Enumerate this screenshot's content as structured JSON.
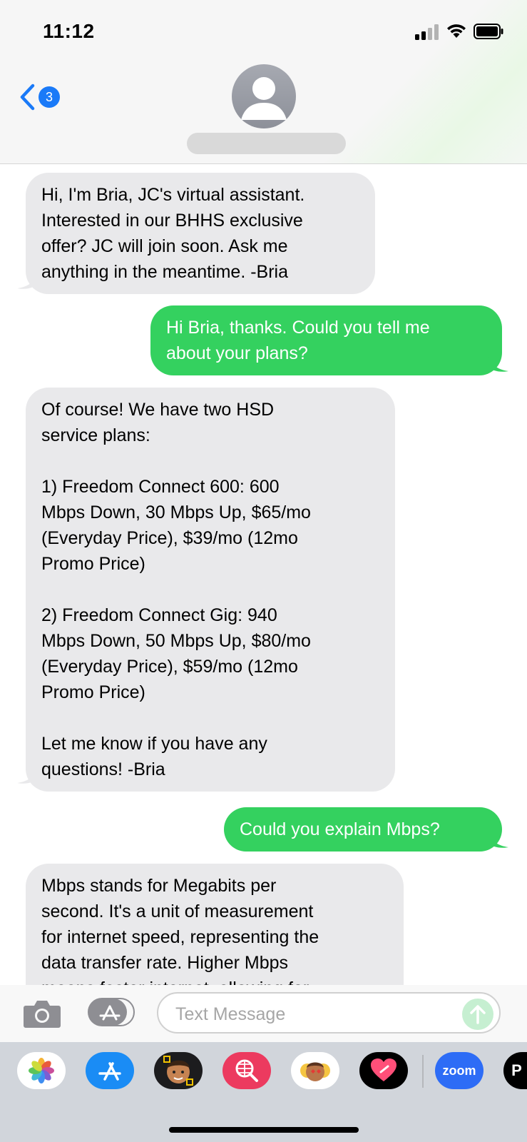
{
  "status_bar": {
    "time": "11:12"
  },
  "nav": {
    "back_badge": "3"
  },
  "messages": [
    {
      "direction": "incoming",
      "text": "Hi, I'm Bria, JC's virtual assistant.\nInterested in our BHHS exclusive\noffer? JC will join soon. Ask me\nanything in the meantime. -Bria"
    },
    {
      "direction": "outgoing",
      "text": "Hi Bria, thanks. Could you tell me\nabout your plans?"
    },
    {
      "direction": "incoming",
      "text": "Of course! We have two HSD\nservice plans:\n\n1) Freedom Connect 600: 600\nMbps Down, 30 Mbps Up, $65/mo\n(Everyday Price), $39/mo (12mo\nPromo Price)\n\n2) Freedom Connect Gig: 940\nMbps Down, 50 Mbps Up, $80/mo\n(Everyday Price), $59/mo (12mo\nPromo Price)\n\nLet me know if you have any\nquestions! -Bria"
    },
    {
      "direction": "outgoing",
      "text": "Could you explain Mbps?"
    },
    {
      "direction": "incoming",
      "text": "Mbps stands for Megabits per\nsecond. It's a unit of measurement\nfor internet speed, representing the\ndata transfer rate. Higher Mbps\nmeans faster internet, allowing for"
    }
  ],
  "compose": {
    "placeholder": "Text Message"
  },
  "app_drawer": {
    "zoom_label": "zoom",
    "paypal_label": "P"
  },
  "colors": {
    "outgoing_bubble": "#34d15f",
    "incoming_bubble": "#e9e9eb",
    "accent": "#1a7af8"
  }
}
